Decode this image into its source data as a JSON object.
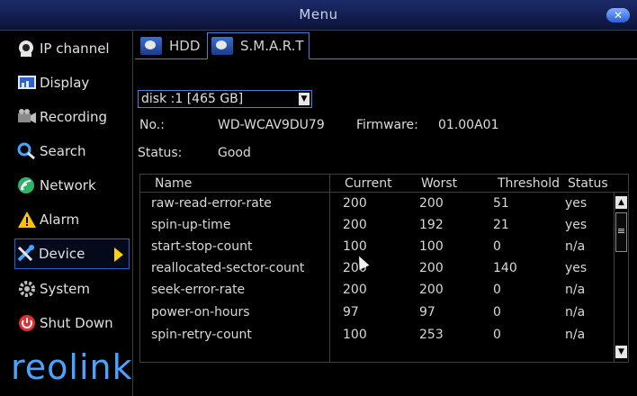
{
  "window": {
    "title": "Menu",
    "close_label": "✕"
  },
  "sidebar": {
    "items": [
      {
        "label": "IP channel",
        "icon": "ip-channel-icon"
      },
      {
        "label": "Display",
        "icon": "display-icon"
      },
      {
        "label": "Recording",
        "icon": "recording-icon"
      },
      {
        "label": "Search",
        "icon": "search-icon"
      },
      {
        "label": "Network",
        "icon": "network-icon"
      },
      {
        "label": "Alarm",
        "icon": "alarm-icon"
      },
      {
        "label": "Device",
        "icon": "device-icon",
        "active": true
      },
      {
        "label": "System",
        "icon": "system-icon"
      },
      {
        "label": "Shut Down",
        "icon": "power-icon"
      }
    ],
    "logo": "reolink"
  },
  "tabs": [
    {
      "label": "HDD"
    },
    {
      "label": "S.M.A.R.T",
      "active": true
    }
  ],
  "disk": {
    "selected": "disk :1 [465 GB]"
  },
  "info": {
    "no_label": "No.:",
    "no_value": "WD-WCAV9DU79",
    "firmware_label": "Firmware:",
    "firmware_value": "01.00A01",
    "status_label": "Status:",
    "status_value": "Good"
  },
  "table": {
    "columns": [
      "Name",
      "Current",
      "Worst",
      "Threshold",
      "Status"
    ],
    "rows": [
      [
        "raw-read-error-rate",
        "200",
        "200",
        "51",
        "yes"
      ],
      [
        "spin-up-time",
        "200",
        "192",
        "21",
        "yes"
      ],
      [
        "start-stop-count",
        "100",
        "100",
        "0",
        "n/a"
      ],
      [
        "reallocated-sector-count",
        "200",
        "200",
        "140",
        "yes"
      ],
      [
        "seek-error-rate",
        "200",
        "200",
        "0",
        "n/a"
      ],
      [
        "power-on-hours",
        "97",
        "97",
        "0",
        "n/a"
      ],
      [
        "spin-retry-count",
        "100",
        "253",
        "0",
        "n/a"
      ]
    ]
  },
  "colors": {
    "accent": "#4d7fe0",
    "active_arrow": "#ffd200",
    "logo": "#4aa3ff"
  }
}
